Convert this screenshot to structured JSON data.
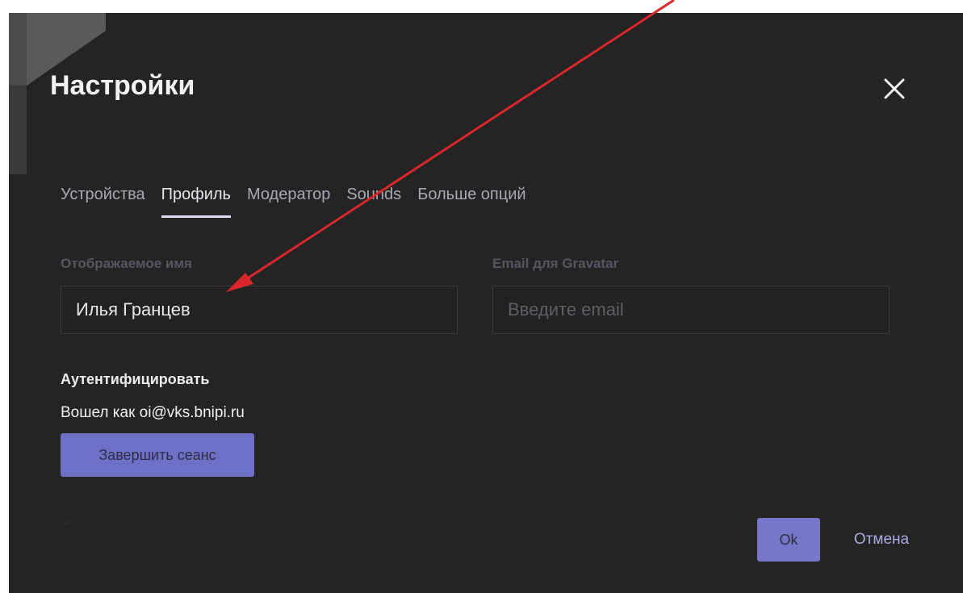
{
  "dialog": {
    "title": "Настройки",
    "close_icon": "close-icon"
  },
  "tabs": [
    {
      "label": "Устройства",
      "active": false
    },
    {
      "label": "Профиль",
      "active": true
    },
    {
      "label": "Модератор",
      "active": false
    },
    {
      "label": "Sounds",
      "active": false
    },
    {
      "label": "Больше опций",
      "active": false
    }
  ],
  "profile": {
    "display_name_label": "Отображаемое имя",
    "display_name_value": "Илья Гранцев",
    "email_label": "Email для Gravatar",
    "email_value": "",
    "email_placeholder": "Введите email"
  },
  "auth": {
    "title": "Аутентифицировать",
    "logged_in_text": "Вошел как oi@vks.bnipi.ru",
    "logout_label": "Завершить сеанс"
  },
  "footer": {
    "ok_label": "Ok",
    "cancel_label": "Отмена"
  },
  "colors": {
    "dialog_bg": "#242424",
    "accent": "#7677c9",
    "annotation_arrow": "#d8262b"
  }
}
